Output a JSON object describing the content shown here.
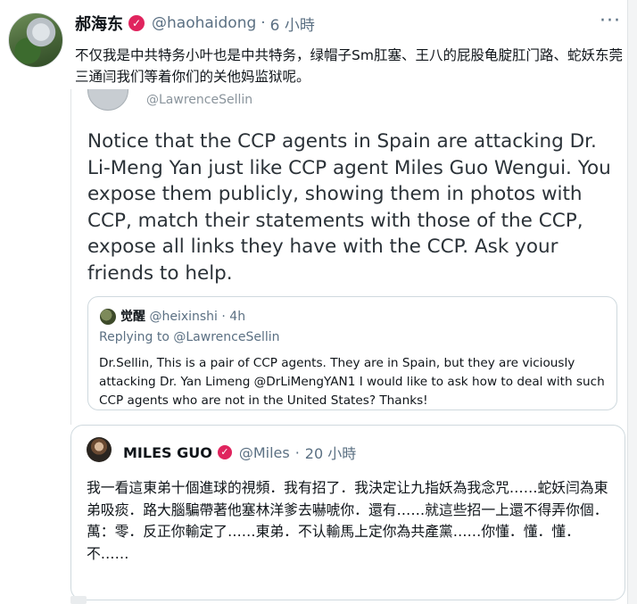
{
  "tweet": {
    "display_name": "郝海东",
    "handle": "@haohaidong",
    "separator": "·",
    "time": "6 小時",
    "verified_mark": "✓",
    "more_label": "···",
    "text": "不仅我是中共特务小叶也是中共特务，绿帽子Sm肛塞、王八的屁股龟腚肛门路、蛇妖东莞三通闫我们等着你们的关他妈监狱呢。"
  },
  "quoted_screenshot": {
    "partial_handle": "@LawrenceSellin",
    "body": "Notice that the CCP agents in Spain are attacking Dr. Li-Meng Yan just like CCP agent Miles Guo Wengui. You expose them publicly, showing them in photos with CCP, match their statements with those of the CCP, expose all links they have with the CCP. Ask your friends to help.",
    "inner_tweet": {
      "display_name": "觉醒",
      "handle": "@heixinshi",
      "separator": "·",
      "time": "4h",
      "replying": "Replying to @LawrenceSellin",
      "text": "Dr.Sellin, This is a pair of CCP agents. They are in Spain, but they are viciously attacking Dr. Yan Limeng @DrLiMengYAN1  I would like to ask how to deal with such CCP agents who are not in the United States? Thanks!"
    }
  },
  "quote_tweet": {
    "display_name": "MILES GUO",
    "verified_mark": "✓",
    "handle": "@Miles",
    "separator": "·",
    "time": "20 小時",
    "text": "我一看這東弟十個進球的視頻．我有招了．我決定让九指妖為我念咒……蛇妖闫為東弟吸痰．路大腦騙帶著他塞林洋爹去嚇唬你．還有……就這些招一上還不得弄你個．萬：零．反正你輸定了……東弟．不认輸馬上定你為共產黨……你懂．懂．懂．不……"
  },
  "colors": {
    "verified": "#e0245e",
    "secondary_text": "#5b7083",
    "border": "#cfd9de"
  }
}
